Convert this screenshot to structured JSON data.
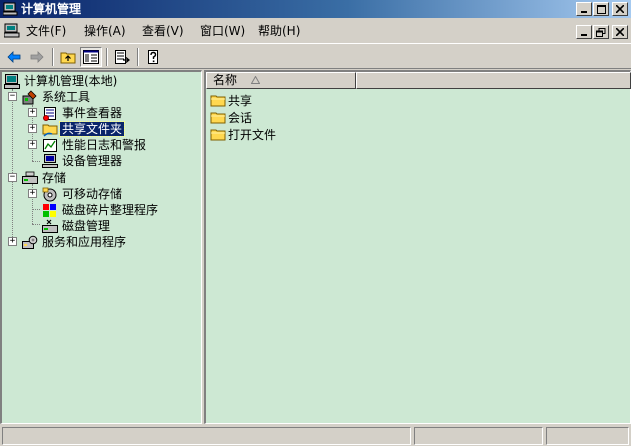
{
  "window": {
    "title": "计算机管理"
  },
  "menu": {
    "items": [
      {
        "label": "文件(F)"
      },
      {
        "label": "操作(A)"
      },
      {
        "label": "查看(V)"
      },
      {
        "label": "窗口(W)"
      },
      {
        "label": "帮助(H)"
      }
    ]
  },
  "tree": {
    "root": "计算机管理(本地)",
    "nodes": [
      {
        "label": "系统工具"
      },
      {
        "label": "事件查看器"
      },
      {
        "label": "共享文件夹"
      },
      {
        "label": "性能日志和警报"
      },
      {
        "label": "设备管理器"
      },
      {
        "label": "存储"
      },
      {
        "label": "可移动存储"
      },
      {
        "label": "磁盘碎片整理程序"
      },
      {
        "label": "磁盘管理"
      },
      {
        "label": "服务和应用程序"
      }
    ]
  },
  "list": {
    "columns": [
      {
        "label": "名称"
      },
      {
        "label": ""
      }
    ],
    "rows": [
      {
        "label": "共享"
      },
      {
        "label": "会话"
      },
      {
        "label": "打开文件"
      }
    ]
  },
  "status": {
    "cells": [
      "",
      "",
      ""
    ]
  },
  "icons": {
    "back": "back-arrow-icon",
    "forward": "forward-arrow-icon",
    "up": "up-folder-icon",
    "show_tree": "show-hide-tree-icon",
    "export": "export-list-icon",
    "help": "help-icon"
  },
  "colors": {
    "title_gradient_start": "#0a246a",
    "title_gradient_end": "#a6caf0",
    "pane_background": "#cde8d3",
    "selection": "#0a246a",
    "chrome": "#d4d0c8"
  }
}
